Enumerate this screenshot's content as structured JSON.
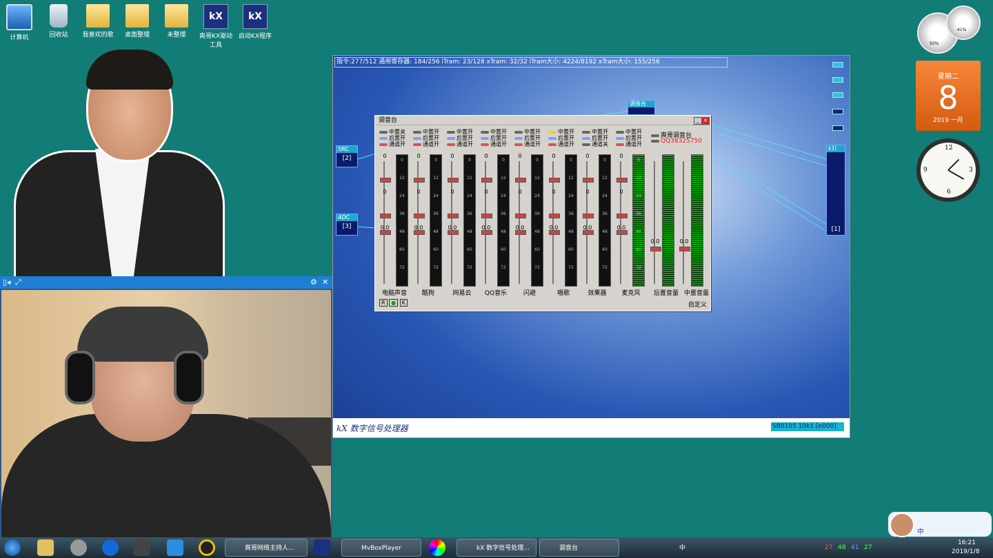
{
  "desktop": {
    "icons": [
      "计算机",
      "回收站",
      "我喜欢的歌",
      "桌面整理",
      "未整理",
      "爽哥KX驱动工具",
      "启动KX程序"
    ]
  },
  "dsp": {
    "status": "指令:277/512 通用寄存器: 184/256 iTram: 23/128 xTram: 32/32 iTram大小: 4224/8192 xTram大小: 155/256",
    "footer_title": "kX 数字信号处理器",
    "card": "SB0105 10k1 [e000]",
    "plugins": {
      "src": {
        "name": "SRC",
        "index": "[2]"
      },
      "adc": {
        "name": "ADC",
        "index": "[3]"
      },
      "k1": {
        "name": "k1l",
        "index": "[1]"
      },
      "mixer": {
        "name": "调音台"
      }
    }
  },
  "mixer": {
    "title": "调音台",
    "channels": [
      {
        "name": "电脑声音",
        "t1": "中置关",
        "t2": "后置开",
        "t3": "通道开",
        "v1": "0",
        "v2": "0",
        "v3": "0.0"
      },
      {
        "name": "酷狗",
        "t1": "中置开",
        "t2": "后置开",
        "t3": "通道开",
        "v1": "0",
        "v2": "0",
        "v3": "0.0"
      },
      {
        "name": "网易云",
        "t1": "中置开",
        "t2": "后置开",
        "t3": "通道开",
        "v1": "0",
        "v2": "0",
        "v3": "0.0"
      },
      {
        "name": "QQ音乐",
        "t1": "中置开",
        "t2": "后置开",
        "t3": "通道开",
        "v1": "0",
        "v2": "0",
        "v3": "0.0"
      },
      {
        "name": "闪避",
        "t1": "中置开",
        "t2": "后置开",
        "t3": "通道开",
        "v1": "0",
        "v2": "0",
        "v3": "0.0"
      },
      {
        "name": "唱歌",
        "t1": "中置开",
        "t2": "后置开",
        "t3": "通道开",
        "v1": "0",
        "v2": "0",
        "v3": "0.0"
      },
      {
        "name": "效果器",
        "t1": "中置开",
        "t2": "后置开",
        "t3": "通道关",
        "v1": "0",
        "v2": "0",
        "v3": "0.0"
      },
      {
        "name": "麦克风",
        "t1": "中置开",
        "t2": "后置开",
        "t3": "通道开",
        "v1": "0",
        "v2": "0",
        "v3": "0.0"
      }
    ],
    "master_rear": {
      "name": "后置音量",
      "v": "0.0"
    },
    "master_center": {
      "name": "中置音量",
      "v": "0.0"
    },
    "brand": "爽哥调音台",
    "contact": "QQ38325750",
    "footer_btns": [
      "R",
      "●",
      "K"
    ],
    "custom": "自定义",
    "meter_ticks": [
      "0",
      "12",
      "24",
      "36",
      "48",
      "60",
      "72"
    ]
  },
  "calendar": {
    "weekday": "星期二",
    "day": "8",
    "month": "2019 一月"
  },
  "gauges": {
    "cpu": "50%",
    "mem": "41%"
  },
  "taskbar": {
    "items": [
      "爽哥网络主持人...",
      "MvBoxPlayer",
      "kX 数字信号处理...",
      "调音台"
    ],
    "ime": "中",
    "tray_nums": [
      "27",
      "48",
      "41",
      "27"
    ],
    "time": "16:21",
    "date": "2019/1/8"
  }
}
